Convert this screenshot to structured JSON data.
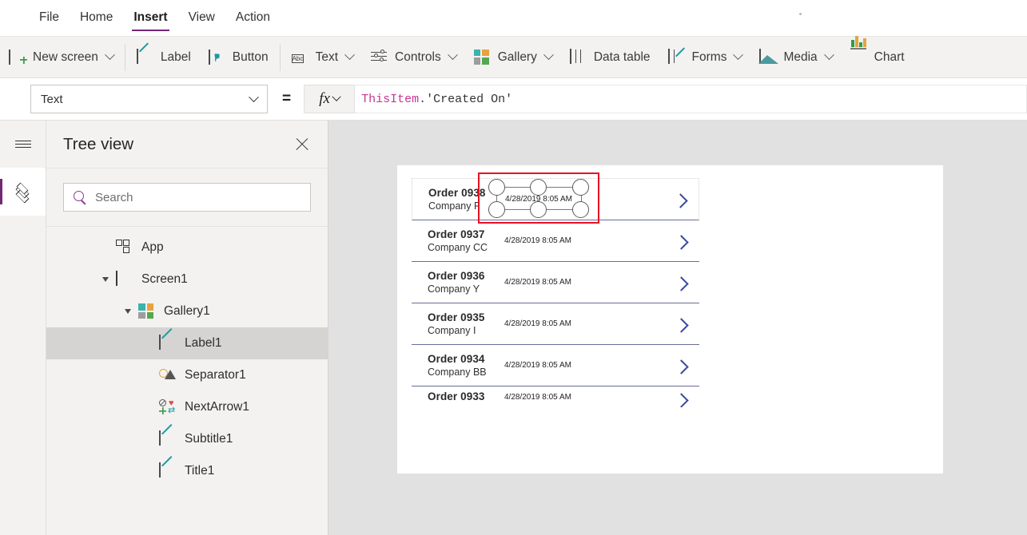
{
  "menu": {
    "items": [
      {
        "label": "File",
        "active": false
      },
      {
        "label": "Home",
        "active": false
      },
      {
        "label": "Insert",
        "active": true
      },
      {
        "label": "View",
        "active": false
      },
      {
        "label": "Action",
        "active": false
      }
    ],
    "accent": "#742774"
  },
  "ribbon": {
    "items": [
      {
        "label": "New screen",
        "icon": "new-screen-icon",
        "caret": true
      },
      {
        "label": "Label",
        "icon": "label-icon",
        "caret": false
      },
      {
        "label": "Button",
        "icon": "button-icon",
        "caret": false
      },
      {
        "label": "Text",
        "icon": "text-abc-icon",
        "caret": true
      },
      {
        "label": "Controls",
        "icon": "controls-icon",
        "caret": true
      },
      {
        "label": "Gallery",
        "icon": "gallery-icon",
        "caret": true
      },
      {
        "label": "Data table",
        "icon": "data-table-icon",
        "caret": false
      },
      {
        "label": "Forms",
        "icon": "forms-icon",
        "caret": true
      },
      {
        "label": "Media",
        "icon": "media-icon",
        "caret": true
      },
      {
        "label": "Chart",
        "icon": "chart-icon",
        "caret": false
      }
    ],
    "gallery_icon_colors": [
      "#3ab3ae",
      "#e8a33d",
      "#9d9d9d",
      "#55a84f"
    ]
  },
  "formula_bar": {
    "property_selected": "Text",
    "equals": "=",
    "fx_label": "fx",
    "formula_object": "ThisItem",
    "formula_punct": ".",
    "formula_string": "'Created On'"
  },
  "tree_panel": {
    "title": "Tree view",
    "close_icon": "close-icon",
    "search_placeholder": "Search",
    "search_value": "",
    "nodes": [
      {
        "label": "App",
        "icon": "app-icon",
        "indent": 0,
        "twisty": false,
        "selected": false
      },
      {
        "label": "Screen1",
        "icon": "screen-icon",
        "indent": 0,
        "twisty": true,
        "selected": false
      },
      {
        "label": "Gallery1",
        "icon": "gallery-icon",
        "indent": 1,
        "twisty": true,
        "selected": false
      },
      {
        "label": "Label1",
        "icon": "label-icon",
        "indent": 2,
        "twisty": false,
        "selected": true
      },
      {
        "label": "Separator1",
        "icon": "separator-icon",
        "indent": 2,
        "twisty": false,
        "selected": false
      },
      {
        "label": "NextArrow1",
        "icon": "next-arrow-icon",
        "indent": 2,
        "twisty": false,
        "selected": false
      },
      {
        "label": "Subtitle1",
        "icon": "label-icon",
        "indent": 2,
        "twisty": false,
        "selected": false
      },
      {
        "label": "Title1",
        "icon": "label-icon",
        "indent": 2,
        "twisty": false,
        "selected": false
      }
    ]
  },
  "canvas": {
    "selection_color": "#e81123",
    "gallery_rows": [
      {
        "title": "Order 0938",
        "subtitle": "Company F",
        "date": "4/28/2019 8:05 AM",
        "template": true,
        "clipped": false
      },
      {
        "title": "Order 0937",
        "subtitle": "Company CC",
        "date": "4/28/2019 8:05 AM",
        "template": false,
        "clipped": false
      },
      {
        "title": "Order 0936",
        "subtitle": "Company Y",
        "date": "4/28/2019 8:05 AM",
        "template": false,
        "clipped": false
      },
      {
        "title": "Order 0935",
        "subtitle": "Company I",
        "date": "4/28/2019 8:05 AM",
        "template": false,
        "clipped": false
      },
      {
        "title": "Order 0934",
        "subtitle": "Company BB",
        "date": "4/28/2019 8:05 AM",
        "template": false,
        "clipped": false
      },
      {
        "title": "Order 0933",
        "subtitle": "",
        "date": "4/28/2019 8:05 AM",
        "template": false,
        "clipped": true
      }
    ]
  }
}
